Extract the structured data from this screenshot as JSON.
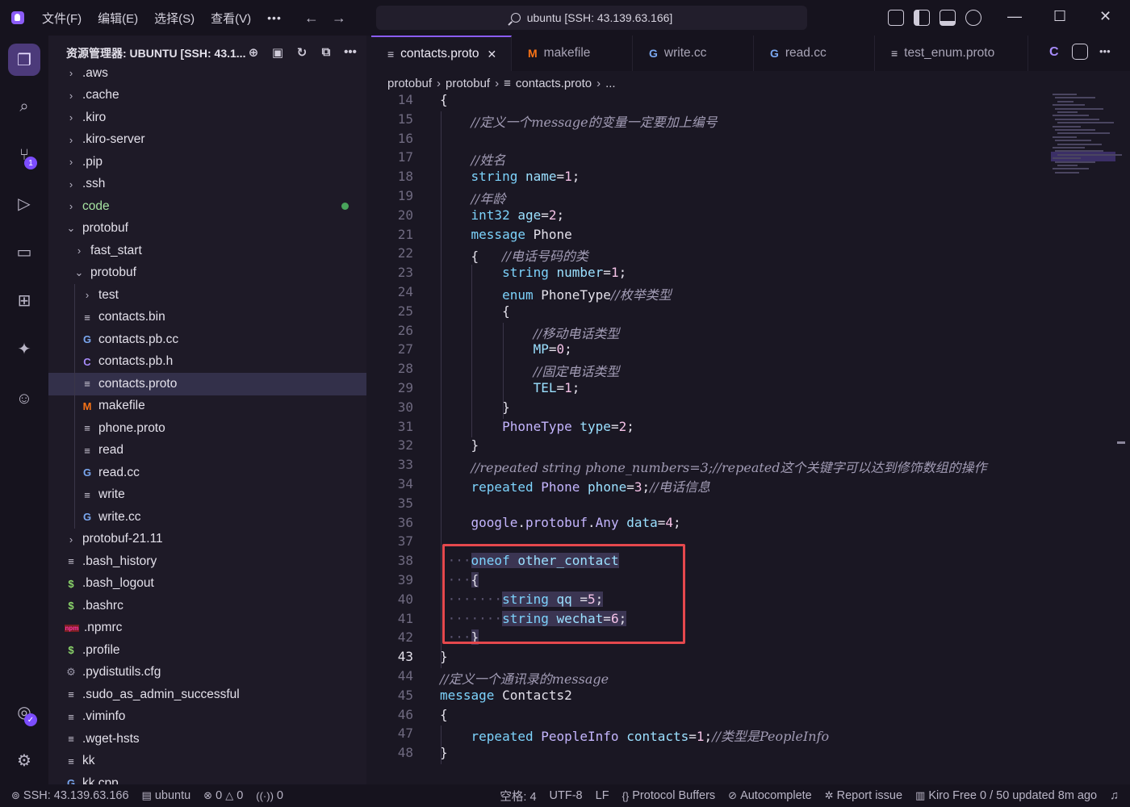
{
  "titlebar": {
    "menus": [
      "文件(F)",
      "编辑(E)",
      "选择(S)",
      "查看(V)"
    ],
    "more": "•••",
    "search_text": "ubuntu [SSH: 43.139.63.166]",
    "icons": [
      "layout-customize-icon",
      "toggle-sidebar-icon",
      "toggle-panel-icon",
      "chat-icon"
    ]
  },
  "activity": {
    "items": [
      "explorer-icon",
      "search-icon",
      "source-control-icon",
      "run-debug-icon",
      "remote-explorer-icon",
      "extensions-icon",
      "kiro-icon",
      "ghost-icon"
    ],
    "source_control_badge": "1",
    "bottom": [
      "account-icon",
      "settings-icon"
    ]
  },
  "sidebar": {
    "title": "资源管理器: UBUNTU [SSH: 43.1...",
    "tree": [
      {
        "label": ".aws",
        "type": "folder",
        "depth": 0,
        "open": false
      },
      {
        "label": ".cache",
        "type": "folder",
        "depth": 0,
        "open": false
      },
      {
        "label": ".kiro",
        "type": "folder",
        "depth": 0,
        "open": false
      },
      {
        "label": ".kiro-server",
        "type": "folder",
        "depth": 0,
        "open": false
      },
      {
        "label": ".pip",
        "type": "folder",
        "depth": 0,
        "open": false
      },
      {
        "label": ".ssh",
        "type": "folder",
        "depth": 0,
        "open": false
      },
      {
        "label": "code",
        "type": "folder",
        "depth": 0,
        "open": false,
        "modified": true
      },
      {
        "label": "protobuf",
        "type": "folder",
        "depth": 0,
        "open": true
      },
      {
        "label": "fast_start",
        "type": "folder",
        "depth": 1,
        "open": false
      },
      {
        "label": "protobuf",
        "type": "folder",
        "depth": 1,
        "open": true
      },
      {
        "label": "test",
        "type": "folder",
        "depth": 2,
        "open": false
      },
      {
        "label": "contacts.bin",
        "type": "text",
        "depth": 2
      },
      {
        "label": "contacts.pb.cc",
        "type": "cpp",
        "depth": 2
      },
      {
        "label": "contacts.pb.h",
        "type": "c",
        "depth": 2
      },
      {
        "label": "contacts.proto",
        "type": "text",
        "depth": 2,
        "selected": true
      },
      {
        "label": "makefile",
        "type": "make",
        "depth": 2
      },
      {
        "label": "phone.proto",
        "type": "text",
        "depth": 2
      },
      {
        "label": "read",
        "type": "text",
        "depth": 2
      },
      {
        "label": "read.cc",
        "type": "cpp",
        "depth": 2
      },
      {
        "label": "write",
        "type": "text",
        "depth": 2
      },
      {
        "label": "write.cc",
        "type": "cpp",
        "depth": 2
      },
      {
        "label": "protobuf-21.11",
        "type": "folder",
        "depth": 0,
        "open": false
      },
      {
        "label": ".bash_history",
        "type": "text",
        "depth": 0
      },
      {
        "label": ".bash_logout",
        "type": "shell",
        "depth": 0
      },
      {
        "label": ".bashrc",
        "type": "shell",
        "depth": 0
      },
      {
        "label": ".npmrc",
        "type": "npm",
        "depth": 0
      },
      {
        "label": ".profile",
        "type": "shell",
        "depth": 0
      },
      {
        "label": ".pydistutils.cfg",
        "type": "gear",
        "depth": 0
      },
      {
        "label": ".sudo_as_admin_successful",
        "type": "text",
        "depth": 0
      },
      {
        "label": ".viminfo",
        "type": "text",
        "depth": 0
      },
      {
        "label": ".wget-hsts",
        "type": "text",
        "depth": 0
      },
      {
        "label": "kk",
        "type": "text",
        "depth": 0
      },
      {
        "label": "kk.cpp",
        "type": "cpp",
        "depth": 0
      }
    ]
  },
  "tabs": [
    {
      "label": "contacts.proto",
      "icon": "≡",
      "active": true
    },
    {
      "label": "makefile",
      "icon": "M"
    },
    {
      "label": "write.cc",
      "icon": "G"
    },
    {
      "label": "read.cc",
      "icon": "G"
    },
    {
      "label": "test_enum.proto",
      "icon": "≡"
    }
  ],
  "tab_overflow_icon": "C",
  "breadcrumb": [
    "protobuf",
    "protobuf",
    "contacts.proto",
    "..."
  ],
  "code": {
    "current_line": 43,
    "lines": [
      {
        "n": 14,
        "t": "{"
      },
      {
        "n": 15,
        "t": "    //定义一个message的变量一定要加上编号"
      },
      {
        "n": 16,
        "t": ""
      },
      {
        "n": 17,
        "t": "    //姓名"
      },
      {
        "n": 18,
        "t": "    string name=1;"
      },
      {
        "n": 19,
        "t": "    //年龄"
      },
      {
        "n": 20,
        "t": "    int32 age=2;"
      },
      {
        "n": 21,
        "t": "    message Phone"
      },
      {
        "n": 22,
        "t": "    {   //电话号码的类"
      },
      {
        "n": 23,
        "t": "        string number=1;"
      },
      {
        "n": 24,
        "t": "        enum PhoneType//枚举类型"
      },
      {
        "n": 25,
        "t": "        {"
      },
      {
        "n": 26,
        "t": "            //移动电话类型"
      },
      {
        "n": 27,
        "t": "            MP=0;"
      },
      {
        "n": 28,
        "t": "            //固定电话类型"
      },
      {
        "n": 29,
        "t": "            TEL=1;"
      },
      {
        "n": 30,
        "t": "        }"
      },
      {
        "n": 31,
        "t": "        PhoneType type=2;"
      },
      {
        "n": 32,
        "t": "    }"
      },
      {
        "n": 33,
        "t": "    //repeated string phone_numbers=3;//repeated这个关键字可以达到修饰数组的操作"
      },
      {
        "n": 34,
        "t": "    repeated Phone phone=3;//电话信息"
      },
      {
        "n": 35,
        "t": ""
      },
      {
        "n": 36,
        "t": "    google.protobuf.Any data=4;"
      },
      {
        "n": 37,
        "t": ""
      },
      {
        "n": 38,
        "t": "    oneof other_contact"
      },
      {
        "n": 39,
        "t": "    {"
      },
      {
        "n": 40,
        "t": "        string qq =5;"
      },
      {
        "n": 41,
        "t": "        string wechat=6;"
      },
      {
        "n": 42,
        "t": "    }"
      },
      {
        "n": 43,
        "t": "}"
      },
      {
        "n": 44,
        "t": "//定义一个通讯录的message"
      },
      {
        "n": 45,
        "t": "message Contacts2"
      },
      {
        "n": 46,
        "t": "{"
      },
      {
        "n": 47,
        "t": "    repeated PeopleInfo contacts=1;//类型是PeopleInfo"
      },
      {
        "n": 48,
        "t": "}"
      }
    ]
  },
  "statusbar": {
    "remote": "SSH: 43.139.63.166",
    "host": "ubuntu",
    "errors": "0",
    "warnings": "0",
    "ports": "0",
    "spaces": "空格: 4",
    "encoding": "UTF-8",
    "eol": "LF",
    "language": "Protocol Buffers",
    "autocomplete": "Autocomplete",
    "report": "Report issue",
    "kiro": "Kiro Free 0 / 50 updated 8m ago"
  },
  "colors": {
    "accent": "#8b5cf6",
    "highlight_box": "#e5484d",
    "modified_dot": "#49a35b"
  }
}
